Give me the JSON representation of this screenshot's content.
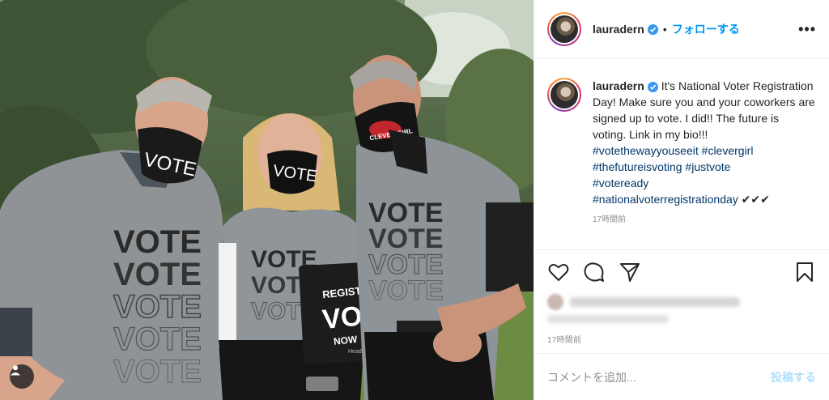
{
  "post": {
    "author": "lauradern",
    "follow_label": "フォローする",
    "separator": "•",
    "more_label": "•••",
    "caption_text": "It's National Voter Registration Day! Make sure you and your coworkers are signed up to vote. I did!! The future is voting. Link in my bio!!!",
    "hashtags": [
      "#votethewayyouseeit",
      "#clevergirl",
      "#thefutureisvoting",
      "#justvote",
      "#voteready",
      "#nationalvoterregistrationday"
    ],
    "caption_suffix": "✔✔✔",
    "caption_time_partial": "17時間前",
    "posted_time": "17時間前",
    "comment_placeholder": "コメントを追加...",
    "post_button": "投稿する"
  },
  "photo": {
    "shirt_text": "VOTE",
    "left_mask_text": "VOTE",
    "center_mask_text": "VOTE",
    "right_mask_text": "CLEVER GIRL",
    "sign_line1": "REGISTER TO",
    "sign_line2": "VOTE",
    "sign_line3": "NOW",
    "sign_small": "HeadCount.org"
  },
  "icons": {
    "like": "heart-icon",
    "comment": "comment-icon",
    "share": "share-icon",
    "save": "bookmark-icon",
    "user_tag": "user-tag-icon",
    "verified": "verified-badge-icon"
  },
  "colors": {
    "link_blue": "#0095f6",
    "hashtag": "#00376b",
    "muted": "#8e8e8e",
    "post_disabled": "#b2dffc"
  }
}
